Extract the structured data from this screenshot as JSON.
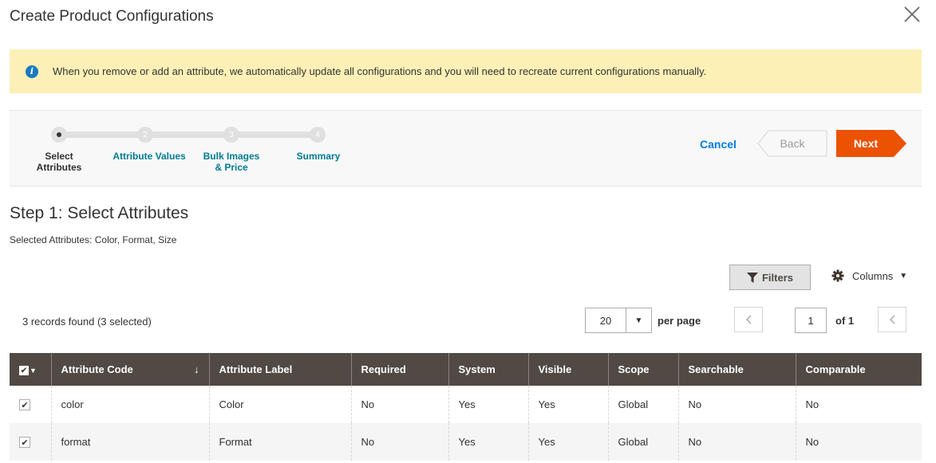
{
  "modal": {
    "title": "Create Product Configurations"
  },
  "notice": {
    "text": "When you remove or add an attribute, we automatically update all configurations and you will need to recreate current configurations manually."
  },
  "steps": [
    {
      "number": "1",
      "label": "Select Attributes",
      "current": true
    },
    {
      "number": "2",
      "label": "Attribute Values"
    },
    {
      "number": "3",
      "label": "Bulk Images & Price"
    },
    {
      "number": "4",
      "label": "Summary"
    }
  ],
  "nav": {
    "cancel": "Cancel",
    "back": "Back",
    "next": "Next",
    "next_color": "#eb5202"
  },
  "content": {
    "step_title": "Step 1: Select Attributes",
    "selected_attributes": "Selected Attributes: Color, Format, Size"
  },
  "toolbar": {
    "filters": "Filters",
    "columns": "Columns",
    "records": "3 records found (3 selected)",
    "per_page_value": "20",
    "per_page_label": "per page",
    "current_page": "1",
    "page_total": "of 1"
  },
  "table": {
    "headers": [
      "Attribute Code",
      "Attribute Label",
      "Required",
      "System",
      "Visible",
      "Scope",
      "Searchable",
      "Comparable"
    ],
    "rows": [
      {
        "checked": true,
        "cells": [
          "color",
          "Color",
          "No",
          "Yes",
          "Yes",
          "Global",
          "No",
          "No"
        ]
      },
      {
        "checked": true,
        "cells": [
          "format",
          "Format",
          "No",
          "Yes",
          "Yes",
          "Global",
          "No",
          "No"
        ]
      }
    ]
  }
}
